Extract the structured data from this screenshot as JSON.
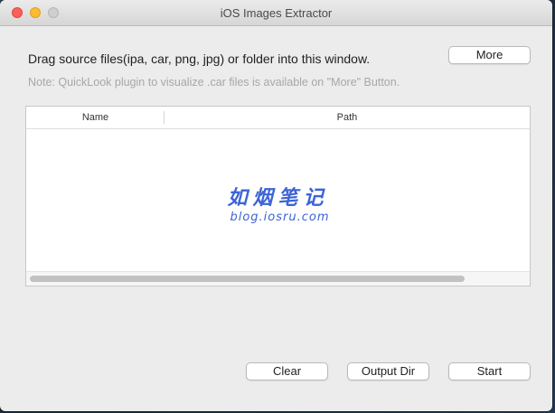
{
  "window": {
    "title": "iOS Images Extractor"
  },
  "header": {
    "instruction": "Drag source files(ipa, car, png, jpg) or folder into this window.",
    "note": "Note: QuickLook plugin to visualize .car files is available on \"More\" Button.",
    "more_label": "More"
  },
  "table": {
    "columns": [
      "Name",
      "Path"
    ],
    "rows": []
  },
  "watermark": {
    "title": "如烟笔记",
    "url": "blog.iosru.com"
  },
  "footer": {
    "clear_label": "Clear",
    "output_label": "Output Dir",
    "start_label": "Start"
  },
  "colors": {
    "close": "#fc5f57",
    "minimize": "#fdbc2e",
    "zoom_disabled": "#cfcfcf",
    "watermark": "#3c64d6"
  }
}
